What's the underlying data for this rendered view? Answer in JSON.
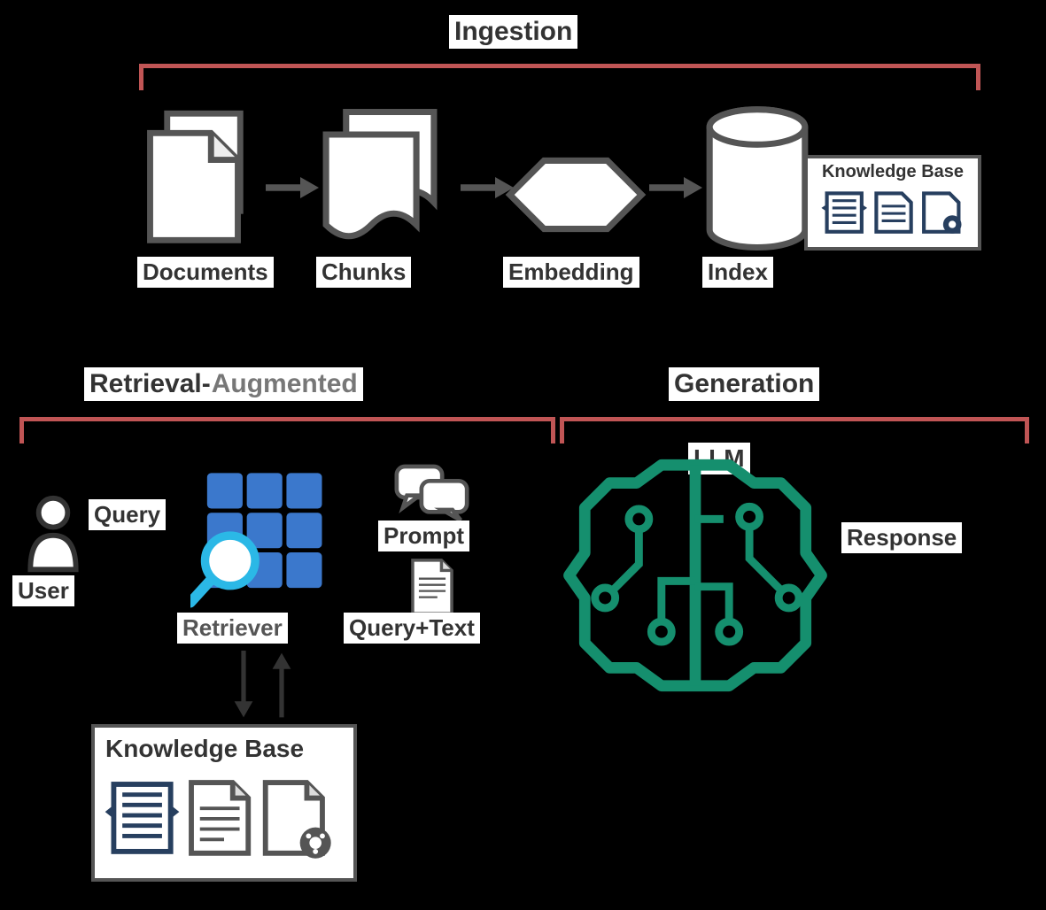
{
  "sections": {
    "ingestion": "Ingestion",
    "retrieval_part1": "Retrieval-",
    "retrieval_part2": "Augmented",
    "generation": "Generation"
  },
  "nodes": {
    "documents": "Documents",
    "chunks": "Chunks",
    "embedding": "Embedding",
    "index": "Index",
    "knowledge_base": "Knowledge Base",
    "user": "User",
    "query": "Query",
    "retriever": "Retriever",
    "prompt": "Prompt",
    "query_text": "Query+Text",
    "llm": "LLM",
    "response": "Response",
    "knowledge_base2": "Knowledge Base"
  }
}
